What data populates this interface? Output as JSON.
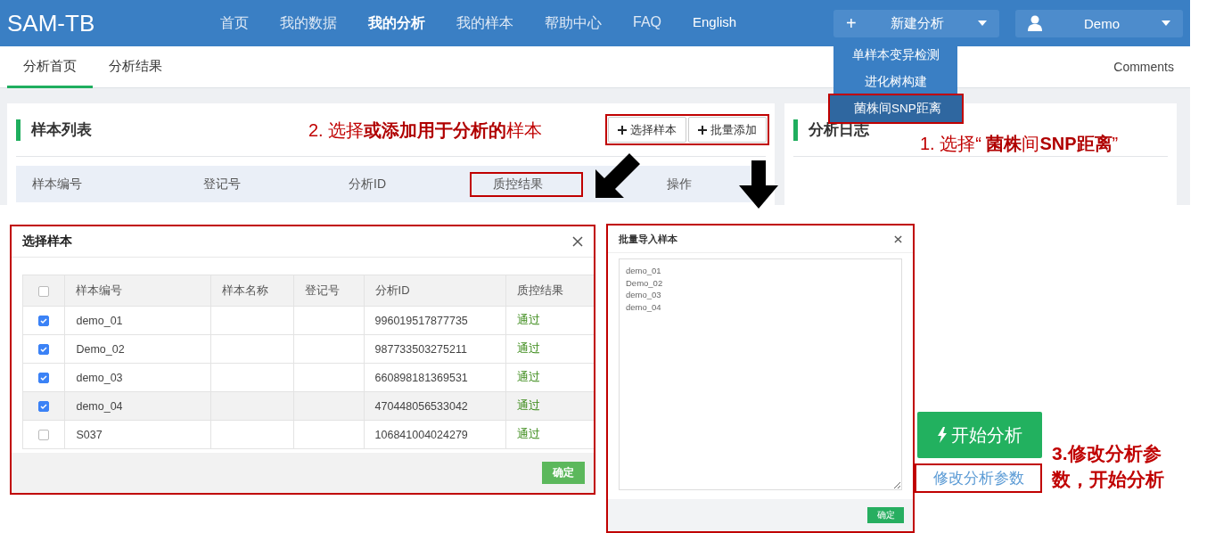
{
  "app": {
    "brand": "SAM-TB",
    "nav": [
      {
        "label": "首页",
        "selected": false
      },
      {
        "label": "我的数据",
        "selected": false
      },
      {
        "label": "我的分析",
        "selected": true
      },
      {
        "label": "我的样本",
        "selected": false
      },
      {
        "label": "帮助中心",
        "selected": false
      },
      {
        "label": "FAQ",
        "selected": false
      },
      {
        "label": "English",
        "selected": false,
        "kind": "language"
      }
    ],
    "new_analysis": {
      "icon": "+",
      "label": "新建分析",
      "items": [
        {
          "label": "单样本变异检测",
          "selected": false,
          "highlighted": false
        },
        {
          "label": "进化树构建",
          "selected": false,
          "highlighted": false
        },
        {
          "label": "菌株间SNP距离",
          "selected": true,
          "highlighted": true
        }
      ]
    },
    "user_menu": {
      "label": "Demo"
    },
    "subtabs": [
      {
        "label": "分析首页",
        "selected": true
      },
      {
        "label": "分析结果",
        "selected": false
      }
    ],
    "comments_link": "Comments",
    "sample_panel": {
      "title": "样本列表",
      "buttons_highlighted": true,
      "buttons": [
        "选择样本",
        "批量添加"
      ],
      "columns": [
        {
          "label": "样本编号",
          "highlighted": false
        },
        {
          "label": "登记号",
          "highlighted": false
        },
        {
          "label": "分析ID",
          "highlighted": false
        },
        {
          "label": "质控结果",
          "highlighted": true
        },
        {
          "label": "操作",
          "highlighted": false
        }
      ]
    },
    "log_panel": {
      "title": "分析日志"
    }
  },
  "annotations": [
    {
      "text": "2. 选择**或添加用于分析的**样本"
    },
    {
      "text": "1. 选择“ **菌株**间**SNP距离**”"
    },
    {
      "text": "3.修改分析参数，开始分析"
    }
  ],
  "select_dialog": {
    "title": "选择样本",
    "highlighted": true,
    "select_all": {
      "checked": false
    },
    "columns": [
      "样本编号",
      "样本名称",
      "登记号",
      "分析ID",
      "质控结果"
    ],
    "rows": [
      {
        "checked": true,
        "hovered": false,
        "sample_id": "demo_01",
        "analysis_id": "996019517877735",
        "qc": "通过"
      },
      {
        "checked": true,
        "hovered": false,
        "sample_id": "Demo_02",
        "analysis_id": "987733503275211",
        "qc": "通过"
      },
      {
        "checked": true,
        "hovered": false,
        "sample_id": "demo_03",
        "analysis_id": "660898181369531",
        "qc": "通过"
      },
      {
        "checked": true,
        "hovered": true,
        "sample_id": "demo_04",
        "analysis_id": "470448056533042",
        "qc": "通过"
      },
      {
        "checked": false,
        "hovered": false,
        "sample_id": "S037",
        "analysis_id": "106841004024279",
        "qc": "通过"
      }
    ],
    "confirm": "确定"
  },
  "bulk_dialog": {
    "title": "批量导入样本",
    "highlighted": true,
    "value": "demo_01\nDemo_02\ndemo_03\ndemo_04",
    "confirm": "确定"
  },
  "actions": {
    "start_button": "开始分析",
    "params_link": "修改分析参数",
    "params_highlighted": true
  }
}
